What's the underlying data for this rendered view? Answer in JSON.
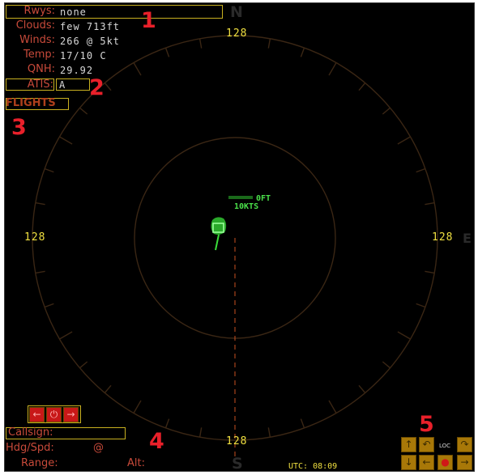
{
  "weather": {
    "rwys_label": "Rwys:",
    "rwys_value": "none",
    "clouds_label": "Clouds:",
    "clouds_value": "few 713ft",
    "winds_label": "Winds:",
    "winds_value": "266 @ 5kt",
    "temp_label": "Temp:",
    "temp_value": "17/10 C",
    "qnh_label": "QNH:",
    "qnh_value": "29.92"
  },
  "atis": {
    "label": "ATIS:",
    "value": "A"
  },
  "flights_label": "FLIGHTS",
  "range_labels": {
    "top": "128",
    "left": "128",
    "right": "128",
    "bottom": "128"
  },
  "compass": {
    "north": "N",
    "south": "S",
    "east": "E"
  },
  "target": {
    "altitude": "0FT",
    "speed": "10KTS"
  },
  "markers": {
    "m1": "1",
    "m2": "2",
    "m3": "3",
    "m4": "4",
    "m5": "5"
  },
  "flight_panel": {
    "callsign_label": "Callsign:",
    "hdgspd_label": "Hdg/Spd:",
    "hdgspd_sep": "@",
    "range_label": "Range:",
    "alt_label": "Alt:"
  },
  "nav_buttons": {
    "left": "←",
    "center": "⏻",
    "right": "→"
  },
  "control_buttons": {
    "up": "↑",
    "undo": "↶",
    "loc": "LOC",
    "turn_right": "↷",
    "down": "↓",
    "left": "←",
    "dot": "●",
    "right": "→"
  },
  "utc": "UTC: 08:09",
  "colors": {
    "background": "#000000",
    "accent_yellow": "#f0e040",
    "label_red": "#c84a3a",
    "target_green": "#3adc3a"
  }
}
